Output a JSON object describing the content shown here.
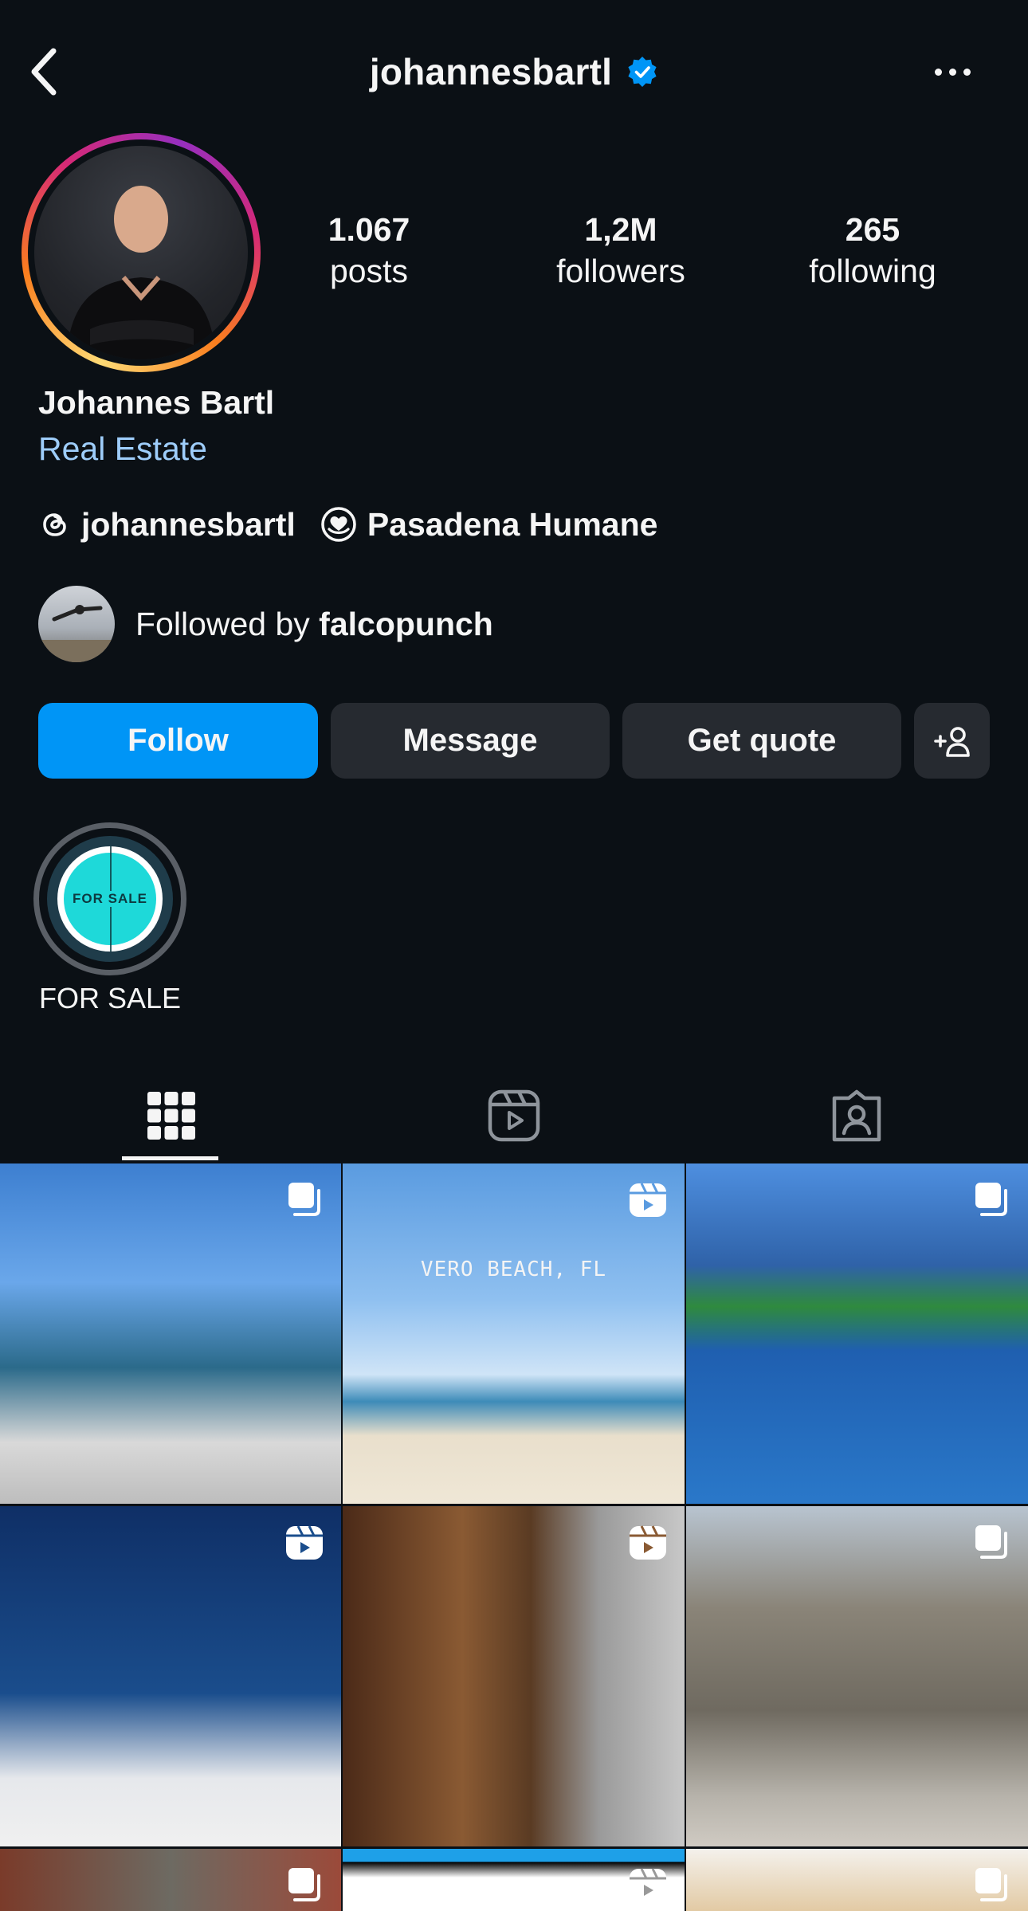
{
  "header": {
    "username": "johannesbartl",
    "verified": true,
    "back_icon": "chevron-left-icon",
    "more_icon": "more-horizontal-icon"
  },
  "profile": {
    "stats": [
      {
        "value": "1.067",
        "label": "posts"
      },
      {
        "value": "1,2M",
        "label": "followers"
      },
      {
        "value": "265",
        "label": "following"
      }
    ],
    "full_name": "Johannes Bartl",
    "category": "Real Estate",
    "threads_handle": "johannesbartl",
    "fundraiser": "Pasadena Humane",
    "followed_by_prefix": "Followed by ",
    "followed_by_user": "falcopunch"
  },
  "actions": {
    "follow": "Follow",
    "message": "Message",
    "get_quote": "Get quote",
    "suggest_icon": "add-person-icon"
  },
  "highlights": [
    {
      "label": "FOR SALE",
      "cover_text": "FOR SALE"
    }
  ],
  "tabs": [
    {
      "name": "grid",
      "icon": "grid-icon",
      "active": true
    },
    {
      "name": "reels",
      "icon": "reels-icon",
      "active": false
    },
    {
      "name": "tagged",
      "icon": "tagged-icon",
      "active": false
    }
  ],
  "posts": [
    {
      "type": "carousel",
      "caption": ""
    },
    {
      "type": "reel",
      "caption": "VERO BEACH, FL"
    },
    {
      "type": "carousel",
      "caption": ""
    },
    {
      "type": "reel",
      "caption": ""
    },
    {
      "type": "reel",
      "caption": ""
    },
    {
      "type": "carousel",
      "caption": ""
    },
    {
      "type": "carousel",
      "caption": ""
    },
    {
      "type": "reel",
      "caption": ""
    },
    {
      "type": "carousel",
      "caption": ""
    }
  ],
  "colors": {
    "background": "#0b1015",
    "primary_button": "#0095f6",
    "secondary_button": "#262a30",
    "category_text": "#9ecdfa",
    "verified_badge": "#0095f6"
  }
}
